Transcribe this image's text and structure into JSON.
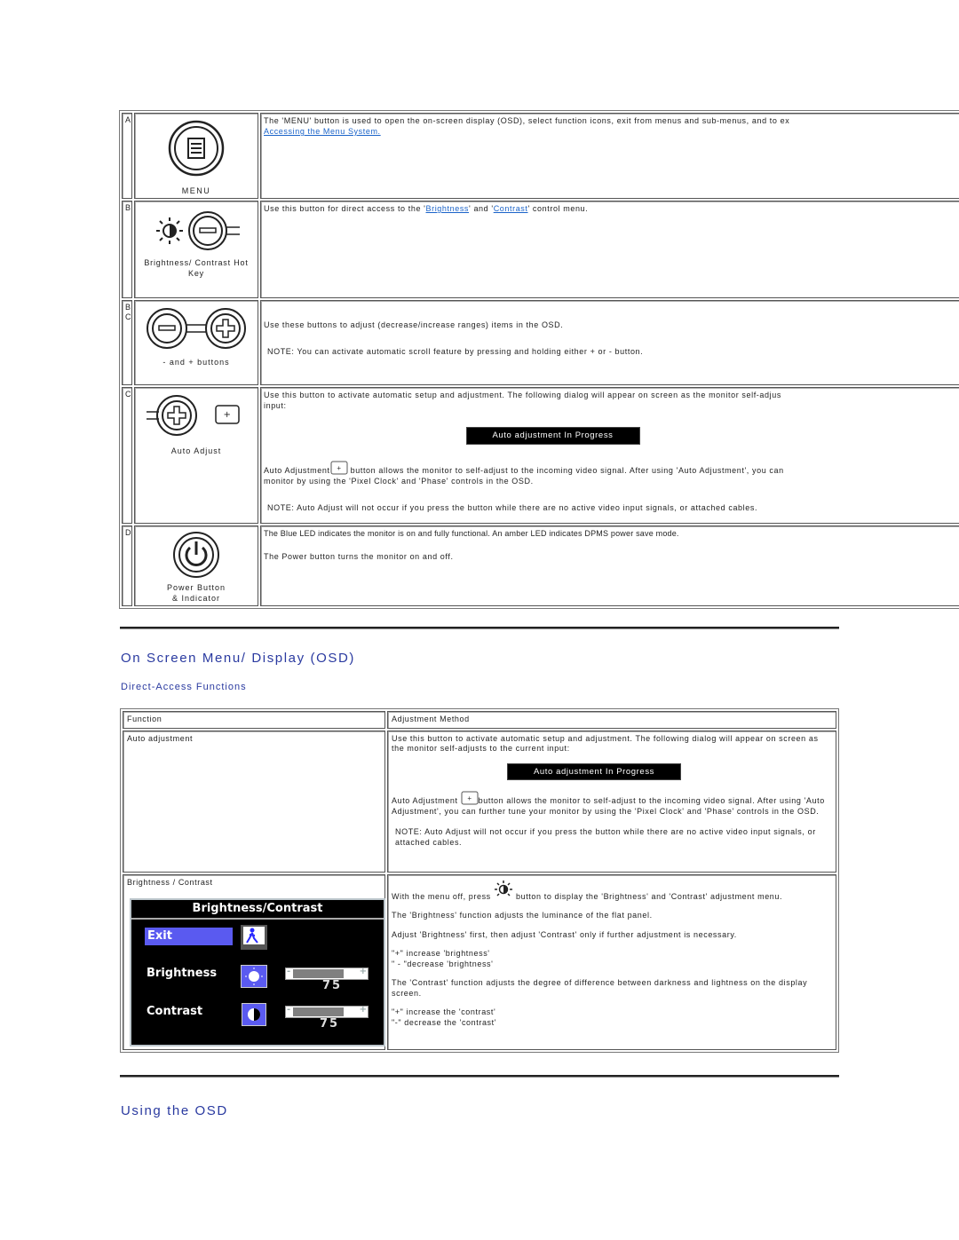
{
  "controls": {
    "rows": [
      {
        "letter": "A",
        "icon": "menu-button-icon",
        "caption": "MENU",
        "paragraphs": [
          {
            "text": "The 'MENU' button is used to open the on-screen display (OSD), select function icons, exit from menus and sub-menus, and to ex"
          },
          {
            "link": "Accessing the Menu System."
          }
        ]
      },
      {
        "letter": "B",
        "icon": "brightness-contrast-hotkey-icon",
        "caption": "Brightness/ Contrast Hot Key",
        "text_before": "Use this button for direct access to the '",
        "link1": "Brightness",
        "text_mid": "' and '",
        "link2": "Contrast",
        "text_after": "' control menu."
      },
      {
        "letter": "B\nC",
        "icon": "minus-plus-buttons-icon",
        "caption": "- and + buttons",
        "paragraphs": [
          "Use these buttons to adjust (decrease/increase ranges) items in the OSD.",
          "NOTE: You can activate automatic scroll feature by pressing and holding either + or - button."
        ]
      },
      {
        "letter": "C",
        "icon": "auto-adjust-icon",
        "caption": "Auto Adjust",
        "intro": "Use this button to activate automatic setup and adjustment. The following dialog will appear on screen as the monitor self-adjus",
        "intro2": "input:",
        "dialog": "Auto adjustment In Progress",
        "p2_before": "Auto Adjustment",
        "p2_after": " button allows the monitor to self-adjust to the incoming video signal. After using 'Auto Adjustment', you can",
        "p2_line2": "monitor by using the 'Pixel Clock' and 'Phase' controls in the OSD.",
        "note": "NOTE: Auto Adjust will not occur if you press the button while there are no active video input signals, or attached cables."
      },
      {
        "letter": "D",
        "icon": "power-button-icon",
        "caption": "Power Button & Indicator",
        "paragraphs": [
          "The Blue LED indicates the monitor is on and fully functional. An amber LED indicates DPMS power save mode.",
          "The Power button turns the monitor on and off."
        ]
      }
    ]
  },
  "sections": {
    "osd_heading": "On Screen Menu/ Display (OSD)",
    "direct_access_heading": "Direct-Access Functions",
    "using_osd_heading": "Using the OSD"
  },
  "direct_access": {
    "headers": [
      "Function",
      "Adjustment Method"
    ],
    "auto": {
      "function": "Auto adjustment",
      "p1": "Use this button to activate automatic setup and adjustment. The following dialog will appear on screen as the monitor self-adjusts to the current input:",
      "dialog": "Auto adjustment In Progress",
      "p2_before": "Auto Adjustment ",
      "p2_after": "button allows the monitor to self-adjust to the incoming video signal. After using 'Auto Adjustment', you can further tune your monitor by using the 'Pixel Clock' and 'Phase' controls in the OSD.",
      "note": "NOTE: Auto Adjust will not occur if you press the button while there are no active video input signals, or attached cables."
    },
    "brightness": {
      "function": "Brightness / Contrast",
      "p1_before": "With the menu off, press ",
      "p1_after": " button to display the 'Brightness' and 'Contrast' adjustment menu.",
      "p2": "The 'Brightness' function adjusts the luminance of the flat panel.",
      "p3": "Adjust 'Brightness' first, then adjust 'Contrast' only if further adjustment is necessary.",
      "p4a": "\"+\" increase 'brightness'",
      "p4b": "\" - \"decrease 'brightness'",
      "p5": "The 'Contrast' function adjusts the degree of difference between darkness and lightness on the display screen.",
      "p6a": "\"+\" increase the 'contrast'",
      "p6b": "\"-\" decrease the 'contrast'",
      "osd": {
        "title": "Brightness/Contrast",
        "exit_label": "Exit",
        "brightness_label": "Brightness",
        "brightness_value": "75",
        "brightness_fraction": 0.75,
        "contrast_label": "Contrast",
        "contrast_value": "75",
        "contrast_fraction": 0.75,
        "highlight_color": "#5a5af0"
      }
    }
  },
  "colors": {
    "heading": "#2a3aa0",
    "link": "#1a63c9"
  }
}
